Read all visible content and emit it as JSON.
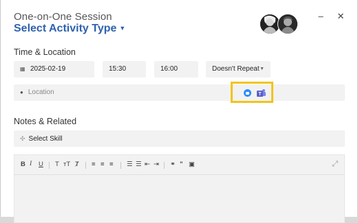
{
  "header": {
    "title": "One-on-One Session",
    "subtitle": "Select Activity Type",
    "subtitle_chevron": "⌄",
    "minimize_label": "–",
    "close_label": "✕"
  },
  "sections": {
    "time_location": "Time & Location",
    "notes_related": "Notes & Related"
  },
  "time": {
    "date": "2025-02-19",
    "start": "15:30",
    "end": "16:00",
    "repeat": "Doesn't Repeat"
  },
  "location": {
    "placeholder": "Location",
    "integrations": [
      "zoom-icon",
      "teams-icon"
    ]
  },
  "skill": {
    "label": "Select Skill"
  },
  "editor": {
    "toolbar": [
      "bold",
      "italic",
      "underline",
      "text-size",
      "text-size-small",
      "clear-format",
      "align-left",
      "align-center",
      "align-right",
      "bullet-list",
      "numbered-list",
      "indent-decrease",
      "indent-increase",
      "link",
      "quote",
      "image",
      "expand"
    ]
  },
  "colors": {
    "accent": "#2f62ad",
    "highlight": "#f0c419",
    "zoom": "#2d8cff",
    "teams": "#5b5fc7"
  }
}
